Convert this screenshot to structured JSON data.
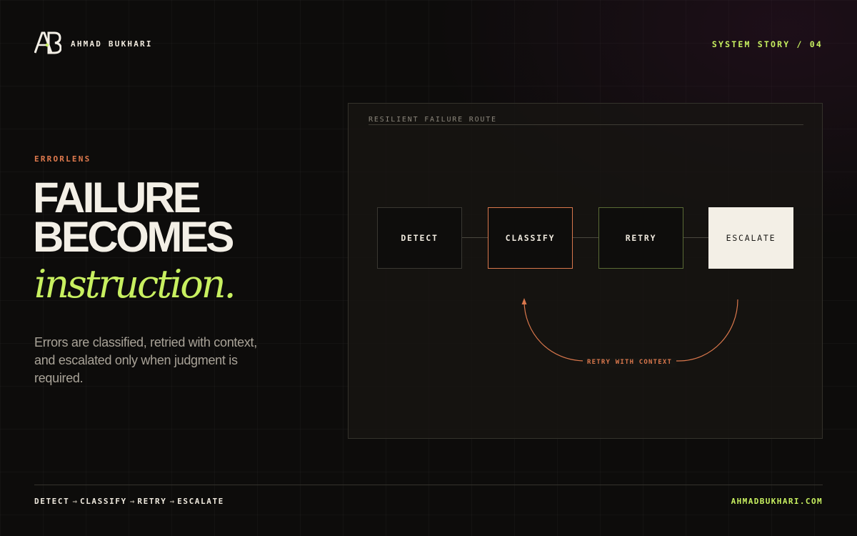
{
  "header": {
    "logo_text": "AB",
    "brand_name": "AHMAD BUKHARI",
    "story_tag": "SYSTEM STORY / 04"
  },
  "hero": {
    "kicker": "ERRORLENS",
    "headline_line1": "FAILURE",
    "headline_line2": "BECOMES",
    "headline_accent": "instruction.",
    "description": "Errors are classified, retried with context, and escalated only when judgment is required."
  },
  "diagram": {
    "title": "RESILIENT FAILURE ROUTE",
    "nodes": [
      {
        "label": "DETECT"
      },
      {
        "label": "CLASSIFY"
      },
      {
        "label": "RETRY"
      },
      {
        "label": "ESCALATE"
      }
    ],
    "loop_label": "RETRY WITH CONTEXT"
  },
  "footer": {
    "flow": [
      "DETECT",
      "CLASSIFY",
      "RETRY",
      "ESCALATE"
    ],
    "arrow": "→",
    "site": "AHMADBUKHARI.COM"
  },
  "colors": {
    "accent_lime": "#c8f060",
    "accent_orange": "#e07a4e",
    "background": "#0d0c0b",
    "text": "#f3efe6"
  }
}
